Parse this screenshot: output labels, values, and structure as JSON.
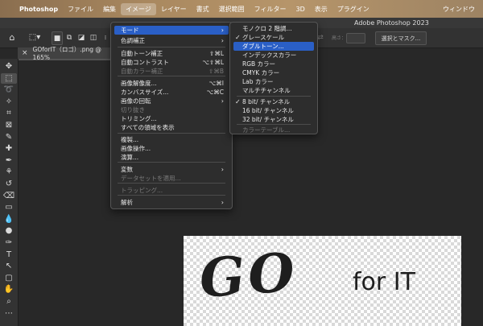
{
  "menubar": {
    "apple": "",
    "app": "Photoshop",
    "file": "ファイル",
    "edit": "編集",
    "image": "イメージ",
    "layer": "レイヤー",
    "type": "書式",
    "select": "選択範囲",
    "filter": "フィルター",
    "3d": "3D",
    "view": "表示",
    "plugins": "プラグイン",
    "window": "ウィンドウ"
  },
  "titlebar": {
    "title": "Adobe Photoshop 2023"
  },
  "options_bar": {
    "home": "⌂",
    "marquee": "⬚▾",
    "height_label": "高さ：",
    "select_mask": "選択とマスク..."
  },
  "document_tab": {
    "close": "×",
    "title": "GOforIT（ロゴ）.png @ 165%"
  },
  "image_menu": {
    "items": [
      {
        "label": "モード",
        "shortcut": "",
        "submenu": true,
        "disabled": false,
        "highlighted": true
      },
      {
        "label": "色調補正",
        "shortcut": "",
        "submenu": true,
        "disabled": false
      },
      {
        "label": "自動トーン補正",
        "shortcut": "⇧⌘L",
        "disabled": false
      },
      {
        "label": "自動コントラスト",
        "shortcut": "⌥⇧⌘L",
        "disabled": false
      },
      {
        "label": "自動カラー補正",
        "shortcut": "⇧⌘B",
        "disabled": true
      },
      {
        "label": "画像解像度...",
        "shortcut": "⌥⌘I",
        "disabled": false
      },
      {
        "label": "カンバスサイズ...",
        "shortcut": "⌥⌘C",
        "disabled": false
      },
      {
        "label": "画像の回転",
        "shortcut": "",
        "submenu": true,
        "disabled": false
      },
      {
        "label": "切り抜き",
        "shortcut": "",
        "disabled": true
      },
      {
        "label": "トリミング...",
        "shortcut": "",
        "disabled": false
      },
      {
        "label": "すべての領域を表示",
        "shortcut": "",
        "disabled": false
      },
      {
        "label": "複製...",
        "shortcut": "",
        "disabled": false
      },
      {
        "label": "画像操作...",
        "shortcut": "",
        "disabled": false
      },
      {
        "label": "演算...",
        "shortcut": "",
        "disabled": false
      },
      {
        "label": "変数",
        "shortcut": "",
        "submenu": true,
        "disabled": false
      },
      {
        "label": "データセットを適用...",
        "shortcut": "",
        "disabled": true
      },
      {
        "label": "トラッピング...",
        "shortcut": "",
        "disabled": true
      },
      {
        "label": "解析",
        "shortcut": "",
        "submenu": true,
        "disabled": false
      }
    ]
  },
  "mode_menu": {
    "items": [
      {
        "label": "モノクロ 2 階調...",
        "checked": false,
        "disabled": false
      },
      {
        "label": "グレースケール",
        "checked": true,
        "disabled": false
      },
      {
        "label": "ダブルトーン...",
        "checked": false,
        "disabled": false,
        "highlighted": true
      },
      {
        "label": "インデックスカラー",
        "checked": false,
        "disabled": false
      },
      {
        "label": "RGB カラー",
        "checked": false,
        "disabled": false
      },
      {
        "label": "CMYK カラー",
        "checked": false,
        "disabled": false
      },
      {
        "label": "Lab カラー",
        "checked": false,
        "disabled": false
      },
      {
        "label": "マルチチャンネル",
        "checked": false,
        "disabled": false
      },
      {
        "label": "8 bit/ チャンネル",
        "checked": true,
        "disabled": false
      },
      {
        "label": "16 bit/ チャンネル",
        "checked": false,
        "disabled": false
      },
      {
        "label": "32 bit/ チャンネル",
        "checked": false,
        "disabled": false
      },
      {
        "label": "カラーテーブル...",
        "checked": false,
        "disabled": true
      }
    ],
    "checkmark": "✓",
    "submenu_arrow": "›"
  },
  "toolbar": {
    "tools": [
      "move-icon",
      "rectangular-marquee-icon",
      "lasso-icon",
      "object-selection-icon",
      "crop-icon",
      "frame-icon",
      "eyedropper-icon",
      "healing-brush-icon",
      "brush-icon",
      "clone-stamp-icon",
      "history-brush-icon",
      "eraser-icon",
      "gradient-icon",
      "blur-icon",
      "dodge-icon",
      "pen-icon",
      "type-icon",
      "path-selection-icon",
      "rectangle-icon",
      "hand-icon",
      "zoom-icon",
      "more-tools-icon"
    ],
    "glyphs": [
      "✥",
      "⬚",
      "➰",
      "✧",
      "⌗",
      "⊠",
      "✎",
      "✚",
      "✒",
      "⚘",
      "↺",
      "⌫",
      "▭",
      "💧",
      "●",
      "✑",
      "T",
      "↖",
      "▢",
      "✋",
      "⌕",
      "⋯"
    ]
  },
  "canvas": {
    "logo_main": "GO",
    "logo_sub": "for IT"
  },
  "colors": {
    "menu_bg": "#2d2d2d",
    "highlight": "#2a5fc6",
    "app_bg": "#282828"
  }
}
